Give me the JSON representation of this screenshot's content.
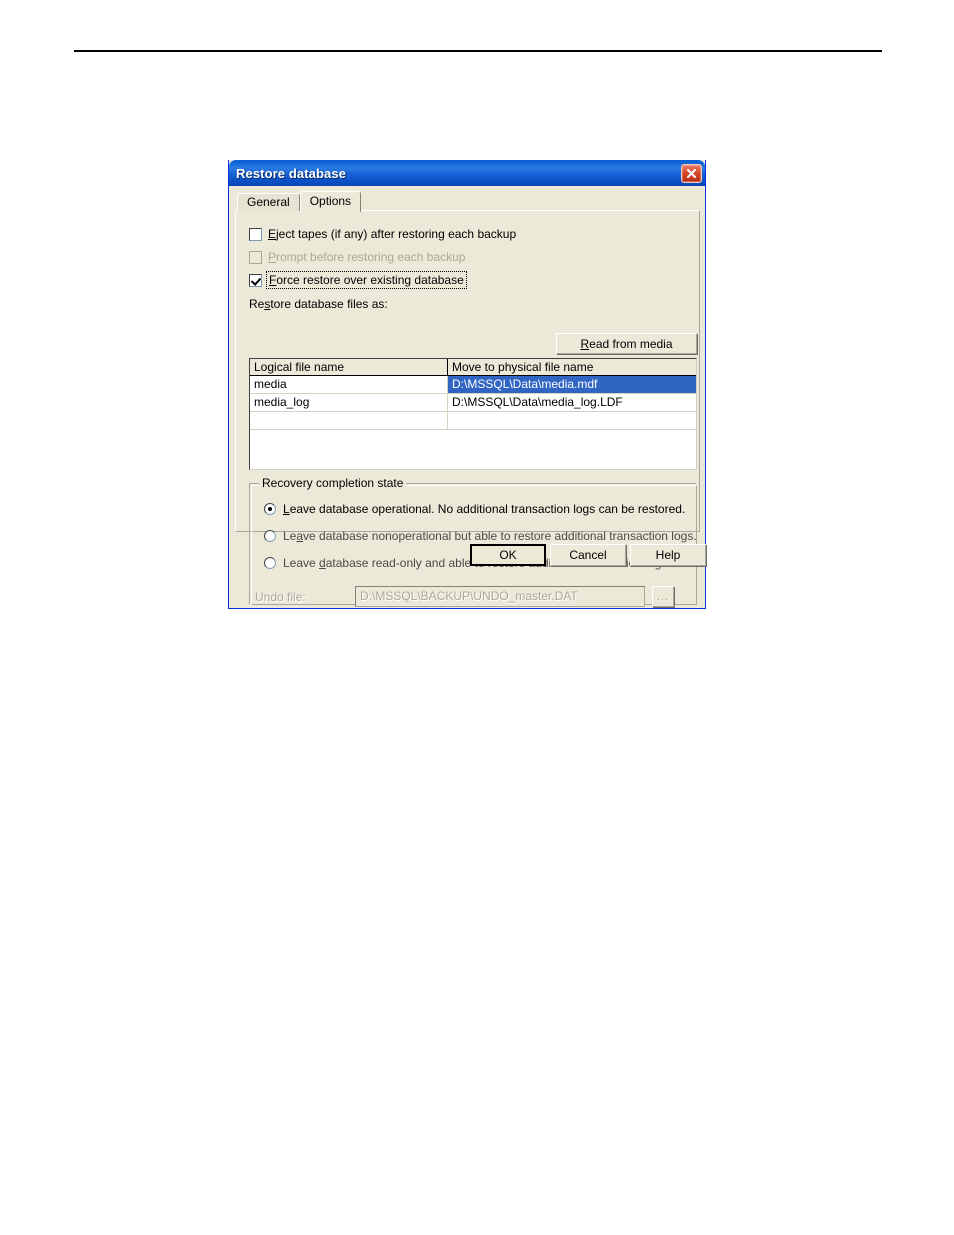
{
  "dialog": {
    "title": "Restore database",
    "close_icon": "close-icon",
    "tabs": [
      {
        "label": "General",
        "active": false
      },
      {
        "label": "Options",
        "active": true
      }
    ],
    "checkboxes": [
      {
        "label": "Eject tapes (if any) after restoring each backup",
        "accelerator": "E",
        "checked": false,
        "disabled": false,
        "focused": false
      },
      {
        "label": "Prompt before restoring each backup",
        "accelerator": "P",
        "checked": false,
        "disabled": true,
        "focused": false
      },
      {
        "label": "Force restore over existing database",
        "accelerator": "F",
        "checked": true,
        "disabled": false,
        "focused": true
      }
    ],
    "read_from_media_label": "Read from media",
    "read_from_media_accelerator": "R",
    "files_label": "Restore database files as:",
    "grid": {
      "columns": [
        "Logical file name",
        "Move to physical file name"
      ],
      "rows": [
        {
          "logical": "media",
          "physical": "D:\\MSSQL\\Data\\media.mdf",
          "selected": true
        },
        {
          "logical": "media_log",
          "physical": "D:\\MSSQL\\Data\\media_log.LDF",
          "selected": false
        },
        {
          "logical": "",
          "physical": "",
          "selected": false
        }
      ]
    },
    "recovery": {
      "title": "Recovery completion state",
      "options": [
        {
          "label": "Leave database operational. No additional transaction logs can be restored.",
          "selected": true
        },
        {
          "label": "Leave database nonoperational but able to restore additional transaction logs.",
          "selected": false
        },
        {
          "label": "Leave database read-only and able to restore additional transaction logs.",
          "selected": false
        }
      ],
      "undo_file_label": "Undo file:",
      "undo_file_value": "D:\\MSSQL\\BACKUP\\UNDO_master.DAT",
      "undo_browse_label": "..."
    },
    "buttons": {
      "ok": "OK",
      "cancel": "Cancel",
      "help": "Help"
    },
    "colors": {
      "titlebar_blue": "#0a5fd4",
      "dialog_face": "#ece9d8",
      "selection_blue": "#3165c4",
      "close_red": "#d8492a",
      "disabled_gray": "#aca899"
    }
  }
}
